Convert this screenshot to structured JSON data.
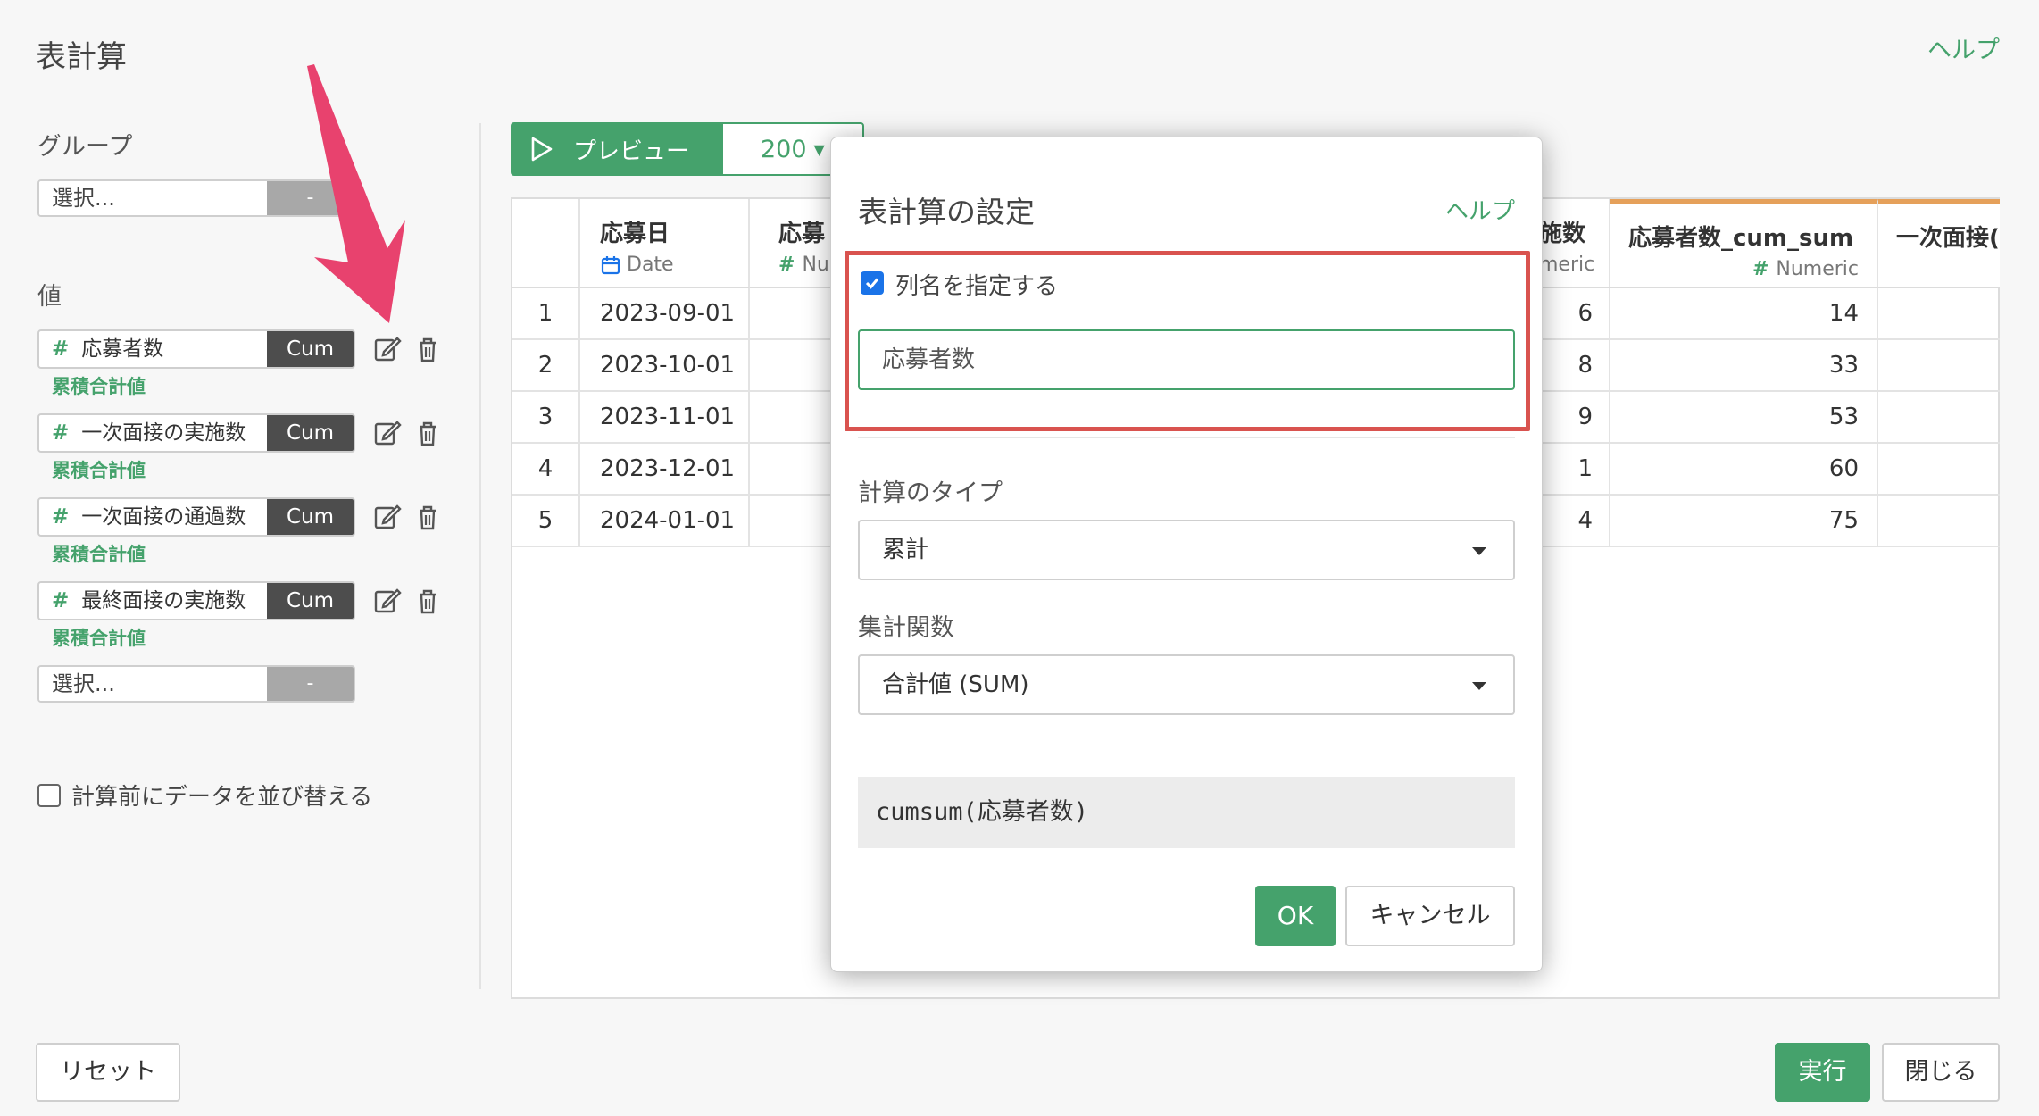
{
  "header": {
    "title": "表計算",
    "help": "ヘルプ"
  },
  "left": {
    "group_label": "グループ",
    "group_select": {
      "placeholder": "選択...",
      "button": "-"
    },
    "values_label": "値",
    "values": [
      {
        "name": "応募者数",
        "badge": "Cum",
        "sub": "累積合計値"
      },
      {
        "name": "一次面接の実施数",
        "badge": "Cum",
        "sub": "累積合計値"
      },
      {
        "name": "一次面接の通過数",
        "badge": "Cum",
        "sub": "累積合計値"
      },
      {
        "name": "最終面接の実施数",
        "badge": "Cum",
        "sub": "累積合計値"
      }
    ],
    "value_select": {
      "placeholder": "選択...",
      "button": "-"
    },
    "sort_checkbox_label": "計算前にデータを並び替える"
  },
  "toolbar": {
    "preview": "プレビュー",
    "rows": "200"
  },
  "table": {
    "columns": [
      {
        "name": "応募日",
        "type": "Date"
      },
      {
        "name": "応募",
        "type": "Nur"
      },
      {
        "name": "施数",
        "type": "meric"
      },
      {
        "name": "応募者数_cum_sum",
        "type": "Numeric"
      },
      {
        "name": "一次面接(",
        "type": ""
      }
    ],
    "rows": [
      {
        "idx": "1",
        "date": "2023-09-01",
        "c3": "6",
        "c4": "14"
      },
      {
        "idx": "2",
        "date": "2023-10-01",
        "c3": "8",
        "c4": "33"
      },
      {
        "idx": "3",
        "date": "2023-11-01",
        "c3": "9",
        "c4": "53"
      },
      {
        "idx": "4",
        "date": "2023-12-01",
        "c3": "1",
        "c4": "60"
      },
      {
        "idx": "5",
        "date": "2024-01-01",
        "c3": "4",
        "c4": "75"
      }
    ]
  },
  "modal": {
    "title": "表計算の設定",
    "help": "ヘルプ",
    "checkbox_label": "列名を指定する",
    "checkbox_checked": true,
    "column_name_value": "応募者数",
    "calc_type_label": "計算のタイプ",
    "calc_type_value": "累計",
    "agg_label": "集計関数",
    "agg_value": "合計値 (SUM)",
    "formula": "cumsum(応募者数)",
    "ok": "OK",
    "cancel": "キャンセル"
  },
  "footer": {
    "reset": "リセット",
    "run": "実行",
    "close": "閉じる"
  },
  "colors": {
    "accent": "#45a26c",
    "highlight": "#d9534f",
    "annotation_arrow": "#e8426e",
    "header_top_border": "#e5a05a"
  }
}
